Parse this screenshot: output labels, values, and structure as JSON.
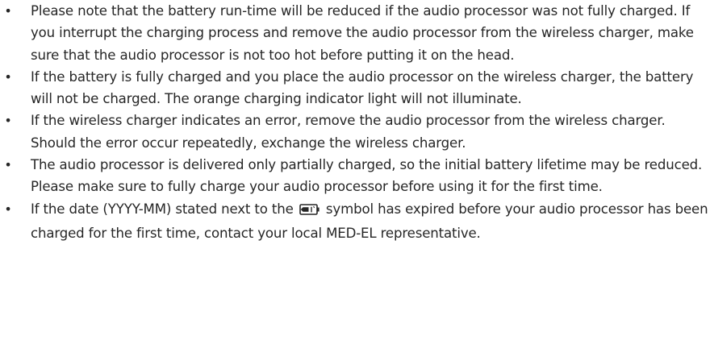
{
  "notes": [
    {
      "text": "Please note that the battery run-time will be reduced if the audio processor was not fully charged. If you interrupt the charging process and remove the audio processor from the wireless charger, make sure that the audio processor is not too hot before putting it on the head."
    },
    {
      "text": "If the battery is fully charged and you place the audio processor on the wireless charger, the battery will not be charged. The orange charging indicator light will not illuminate."
    },
    {
      "text": "If the wireless charger indicates an error, remove the audio processor from the wireless charger. Should the error occur repeatedly, exchange the wireless charger."
    },
    {
      "text": "The audio processor is delivered only partially charged, so the initial battery lifetime may be reduced. Please make sure to fully charge your audio processor before using it for the first time."
    },
    {
      "text_before": "If the date (YYYY-MM) stated next to the",
      "symbol_icon": "battery-charge-date-icon",
      "text_after": "symbol has expired before your audio processor has been charged for the first time, contact your local MED-EL representative."
    }
  ],
  "bullet_glyph": "•"
}
